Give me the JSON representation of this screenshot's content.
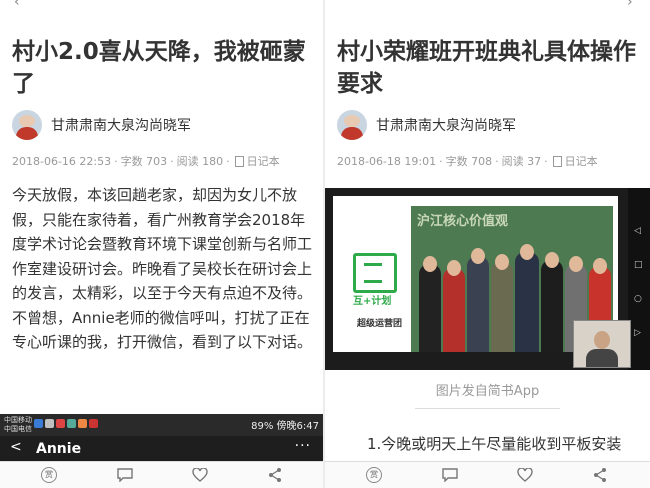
{
  "left": {
    "title": "村小2.0喜从天降，我被砸蒙了",
    "author": "甘肃肃南大泉沟尚晓军",
    "meta": {
      "date": "2018-06-16 22:53",
      "words": "字数 703",
      "reads": "阅读 180",
      "category": "日记本"
    },
    "body": "今天放假，本该回趟老家，却因为女儿不放假，只能在家待着，看广州教育学会2018年度学术讨论会暨教育环境下课堂创新与名师工作室建设研讨会。昨晚看了吴校长在研讨会上的发言，太精彩，以至于今天有点迫不及待。不曾想，Annie老师的微信呼叫，打扰了正在专心听课的我，打开微信，看到了以下对话。",
    "embedded_screen": {
      "carrier_line1": "中国移动",
      "carrier_line2": "中国电信",
      "status_right": "89%  傍晚6:47",
      "chat_name": "Annie",
      "back_glyph": "<",
      "more_glyph": "···"
    },
    "bottom_bar": {
      "reward_label": "赏"
    }
  },
  "right": {
    "title": "村小荣耀班开班典礼具体操作要求",
    "author": "甘肃肃南大泉沟尚晓军",
    "meta": {
      "date": "2018-06-18 19:01",
      "words": "字数 708",
      "reads": "阅读 37",
      "category": "日记本"
    },
    "image": {
      "banner_text": "沪江核心价值观",
      "logo_text": "互+计划",
      "team_label": "超级运营团"
    },
    "caption": "图片发自简书App",
    "body_first_line": "1.今晚或明天上午尽量能收到平板安装",
    "bottom_bar": {
      "reward_label": "赏"
    }
  },
  "icons": [
    "chevron-left-icon",
    "chevron-right-icon",
    "reward-icon",
    "comment-icon",
    "heart-icon",
    "share-icon",
    "document-icon"
  ],
  "colors": {
    "text": "#333333",
    "meta": "#999999",
    "brand_green": "#2eaa4a"
  }
}
